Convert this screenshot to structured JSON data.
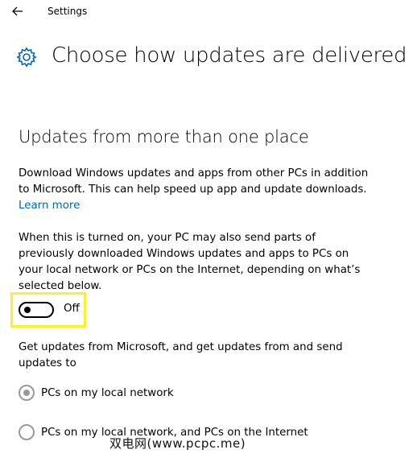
{
  "window": {
    "title": "Settings"
  },
  "page": {
    "title": "Choose how updates are delivered"
  },
  "section": {
    "heading": "Updates from more than one place",
    "description": "Download Windows updates and apps from other PCs in addition to Microsoft. This can help speed up app and update downloads.",
    "learn_more": "Learn more",
    "info": "When this is turned on, your PC may also send parts of previously downloaded Windows updates and apps to PCs on your local network or PCs on the Internet, depending on what’s selected below."
  },
  "toggle": {
    "label": "Off",
    "state": "off"
  },
  "source": {
    "prompt": "Get updates from Microsoft, and get updates from and send updates to",
    "options": [
      {
        "label": "PCs on my local network",
        "selected": true
      },
      {
        "label": "PCs on my local network, and PCs on the Internet",
        "selected": false
      }
    ]
  },
  "watermark": "双电网(www.pcpc.me)",
  "colors": {
    "link": "#0066b4",
    "highlight": "#f6f22c",
    "radio": "#999999"
  }
}
